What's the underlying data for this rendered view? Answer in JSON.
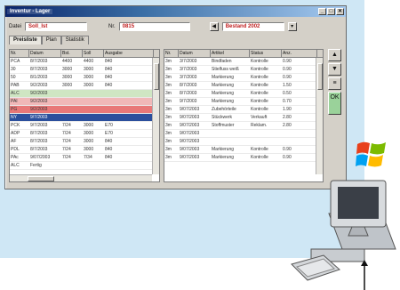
{
  "window": {
    "title": "Inventur - Lager",
    "buttons": [
      "_",
      "□",
      "✕"
    ]
  },
  "toolbar": {
    "label_left": "Datei",
    "input_left": "Soll_Ist",
    "label_mid": "Nr.",
    "input_mid": "0815",
    "input_right": "Bestand 2002"
  },
  "tabs": [
    "Preisliste",
    "Plan",
    "Statistik"
  ],
  "left_table": {
    "columns": [
      "Nr.",
      "Datum",
      "Bst.",
      "Soll",
      "Ausgabe"
    ],
    "rows": [
      [
        "PCA",
        "8/7/2003",
        "4400",
        "4400",
        "840"
      ],
      [
        "30",
        "8/7/2003",
        "3000",
        "3000",
        "840"
      ],
      [
        "50",
        "8/1/2003",
        "3000",
        "3000",
        "840"
      ],
      [
        "PAB",
        "9/2/2003",
        "3000",
        "3000",
        "840"
      ],
      [
        "ALC",
        "9/2/2003",
        "",
        "",
        ""
      ],
      [
        "PAI",
        "9/2/2003",
        "",
        "",
        ""
      ],
      [
        "PG",
        "9/2/2003",
        "",
        "",
        ""
      ],
      [
        "NY",
        "9/7/2003",
        "",
        "",
        ""
      ],
      [
        "PCK",
        "9/7/2003",
        "7/24",
        "3000",
        "E70"
      ],
      [
        "ADP",
        "8/7/2003",
        "7/24",
        "3000",
        "E70"
      ],
      [
        "AF",
        "8/7/2003",
        "7/24",
        "3000",
        "840"
      ],
      [
        "PDL",
        "8/7/2003",
        "7/24",
        "3000",
        "840"
      ],
      [
        "PAc",
        "9/07/2003",
        "7/24",
        "7/34",
        "840"
      ],
      [
        "ALC",
        "Fertig",
        "",
        "",
        ""
      ]
    ]
  },
  "right_table": {
    "columns": [
      "Nr.",
      "Datum",
      "Artikel",
      "Status",
      "Anz."
    ],
    "rows": [
      [
        "3m",
        "3/7/2003",
        "Bindfaden",
        "Kontrolle",
        "0.90"
      ],
      [
        "3m",
        "3/7/2003",
        "Stielfuss weiß",
        "Kontrolle",
        "0.90"
      ],
      [
        "3m",
        "3/7/2003",
        "Markierung",
        "Kontrolle",
        "0.90"
      ],
      [
        "3m",
        "8/7/2003",
        "Markierung",
        "Kontrolle",
        "1.50"
      ],
      [
        "3m",
        "8/7/2003",
        "Markierung",
        "Kontrolle",
        "0.50"
      ],
      [
        "3m",
        "9/7/2003",
        "Markierung",
        "Kontrolle",
        "0.70"
      ],
      [
        "3m",
        "9/07/2003",
        "Zubehörteile",
        "Kontrolle",
        "1.90"
      ],
      [
        "3m",
        "9/07/2003",
        "Stückwerk",
        "Verkauft",
        "2.80"
      ],
      [
        "3m",
        "9/07/2003",
        "Stoffmuster",
        "Reklam.",
        "2.80"
      ],
      [
        "3m",
        "9/07/2003",
        "",
        "",
        ""
      ],
      [
        "3m",
        "9/07/2003",
        "",
        "",
        ""
      ],
      [
        "3m",
        "9/07/2003",
        "Markierung",
        "Kontrolle",
        "0.90"
      ],
      [
        "3m",
        "9/07/2003",
        "Markierung",
        "Kontrolle",
        "0.90"
      ]
    ]
  },
  "side_buttons": [
    "▲",
    "▼",
    "≡",
    "OK"
  ],
  "colors": {
    "title_start": "#0a246a",
    "title_end": "#a6caf0",
    "highlight_red": "#e87878",
    "highlight_pink": "#f0b8b8",
    "highlight_green": "#cfe6c3",
    "selection_blue": "#2b4f9c"
  },
  "icons": {
    "os_logo": "windows-logo-icon",
    "computer": "desktop-computer-icon"
  }
}
